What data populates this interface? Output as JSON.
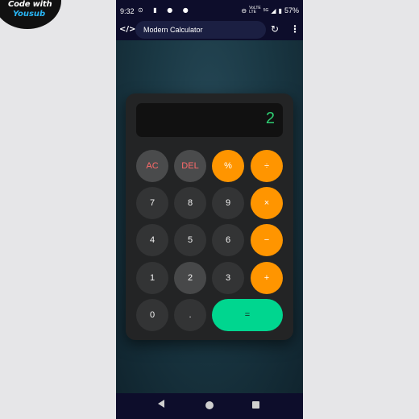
{
  "watermark": {
    "line1": "Code with",
    "line2": "Yousub"
  },
  "status_bar": {
    "time": "9:32",
    "left_icons": "⊙ ▮ ● ●",
    "network_top": "VoLTE",
    "network_bottom": "LTE",
    "signal": "5G",
    "battery": "57%"
  },
  "app_bar": {
    "code_icon": "</>",
    "title": "Modern Calculator",
    "reload_icon": "↻",
    "menu_icon": "⋮"
  },
  "calculator": {
    "display_value": "2",
    "keys": {
      "ac": "AC",
      "del": "DEL",
      "percent": "%",
      "divide": "÷",
      "seven": "7",
      "eight": "8",
      "nine": "9",
      "multiply": "×",
      "four": "4",
      "five": "5",
      "six": "6",
      "minus": "−",
      "one": "1",
      "two": "2",
      "three": "3",
      "plus": "+",
      "zero": "0",
      "dot": ".",
      "equals": "="
    }
  },
  "colors": {
    "accent_orange": "#ff9500",
    "equals_green": "#00d68f",
    "display_text": "#2ecc71",
    "function_text": "#ff6b6b",
    "phone_bar": "#0d0d2b"
  }
}
